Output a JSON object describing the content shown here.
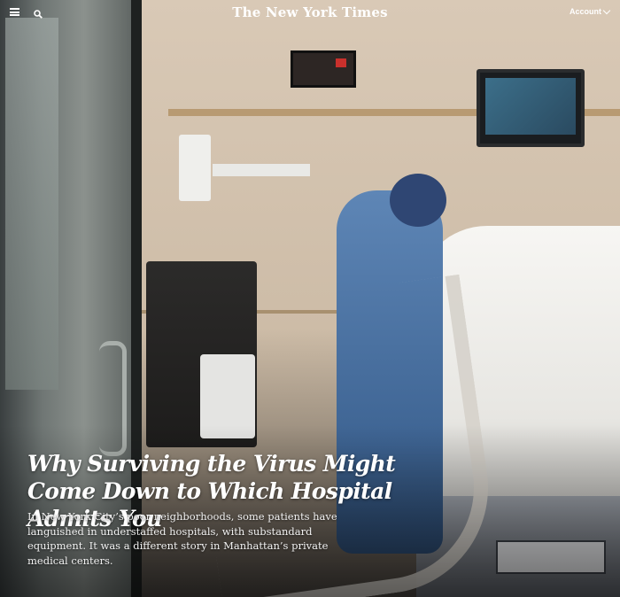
{
  "header": {
    "logo": "The New York Times",
    "account_label": "Account",
    "icons": {
      "menu": "hamburger-menu-icon",
      "search": "search-icon",
      "account_chevron": "chevron-down-icon"
    }
  },
  "article": {
    "headline": "Why Surviving the Virus Might Come Down to Which Hospital Admits You",
    "summary": "In New York City’s poor neighborhoods, some patients have languished in understaffed hospitals, with substandard equipment. It was a different story in Manhattan’s private medical centers."
  },
  "colors": {
    "text": "#ffffff",
    "scrub_blue": "#4f76a6"
  }
}
